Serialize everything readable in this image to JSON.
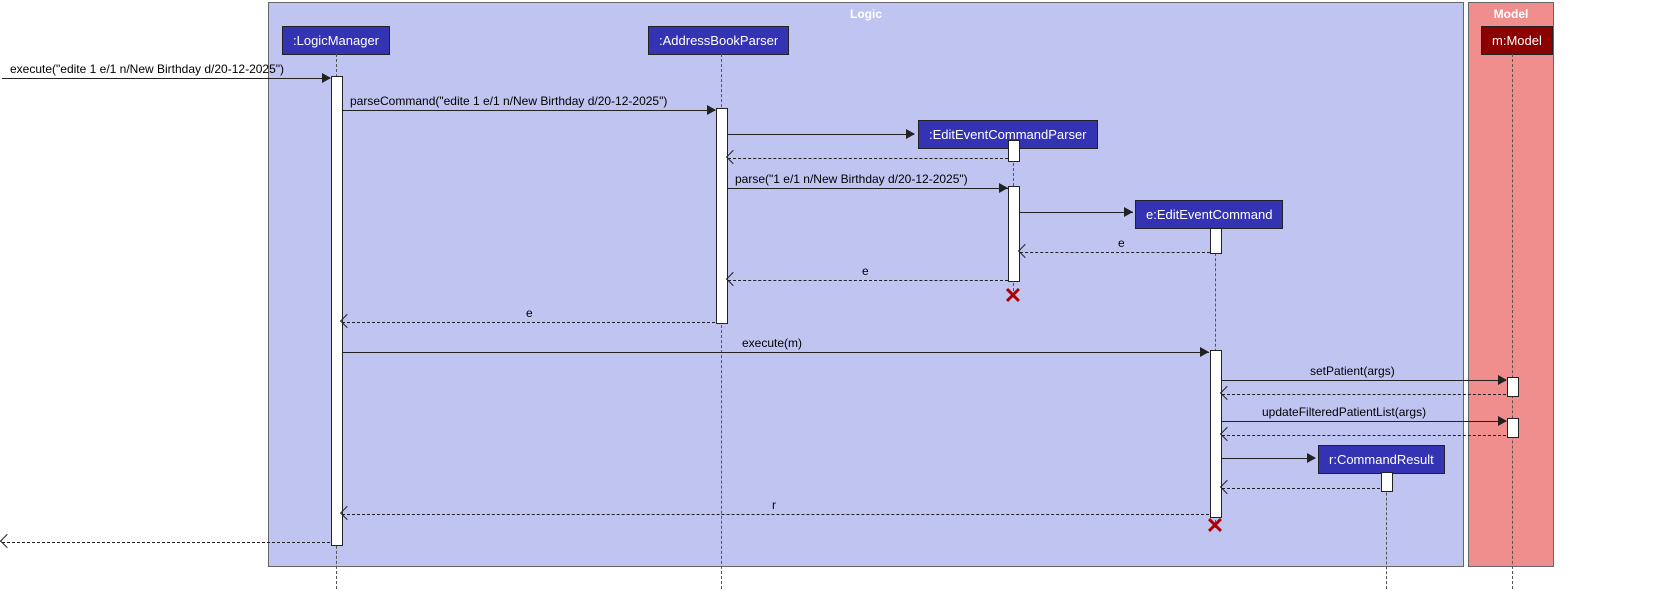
{
  "regions": {
    "logic": "Logic",
    "model": "Model"
  },
  "participants": {
    "logicManager": ":LogicManager",
    "addressBookParser": ":AddressBookParser",
    "editEventCommandParser": ":EditEventCommandParser",
    "editEventCommand": "e:EditEventCommand",
    "commandResult": "r:CommandResult",
    "model": "m:Model"
  },
  "messages": {
    "executeIn": "execute(\"edite 1 e/1 n/New Birthday d/20-12-2025\")",
    "parseCommand": "parseCommand(\"edite 1 e/1 n/New Birthday d/20-12-2025\")",
    "parse": "parse(\"1 e/1 n/New Birthday d/20-12-2025\")",
    "e1": "e",
    "e2": "e",
    "e3": "e",
    "executeM": "execute(m)",
    "setPatient": "setPatient(args)",
    "updateFiltered": "updateFilteredPatientList(args)",
    "r": "r"
  },
  "chart_data": {
    "type": "sequence-diagram",
    "regions": [
      {
        "name": "Logic",
        "participants": [
          ":LogicManager",
          ":AddressBookParser",
          ":EditEventCommandParser",
          "e:EditEventCommand",
          "r:CommandResult"
        ]
      },
      {
        "name": "Model",
        "participants": [
          "m:Model"
        ]
      }
    ],
    "lifelines": [
      ":LogicManager",
      ":AddressBookParser",
      ":EditEventCommandParser",
      "e:EditEventCommand",
      "r:CommandResult",
      "m:Model"
    ],
    "messages": [
      {
        "from": "Caller",
        "to": ":LogicManager",
        "label": "execute(\"edite 1 e/1 n/New Birthday d/20-12-2025\")",
        "type": "sync"
      },
      {
        "from": ":LogicManager",
        "to": ":AddressBookParser",
        "label": "parseCommand(\"edite 1 e/1 n/New Birthday d/20-12-2025\")",
        "type": "sync"
      },
      {
        "from": ":AddressBookParser",
        "to": ":EditEventCommandParser",
        "label": "",
        "type": "create"
      },
      {
        "from": ":EditEventCommandParser",
        "to": ":AddressBookParser",
        "label": "",
        "type": "return"
      },
      {
        "from": ":AddressBookParser",
        "to": ":EditEventCommandParser",
        "label": "parse(\"1 e/1 n/New Birthday d/20-12-2025\")",
        "type": "sync"
      },
      {
        "from": ":EditEventCommandParser",
        "to": "e:EditEventCommand",
        "label": "",
        "type": "create"
      },
      {
        "from": "e:EditEventCommand",
        "to": ":EditEventCommandParser",
        "label": "e",
        "type": "return"
      },
      {
        "from": ":EditEventCommandParser",
        "to": ":AddressBookParser",
        "label": "e",
        "type": "return"
      },
      {
        "from": ":EditEventCommandParser",
        "to": null,
        "label": "",
        "type": "destroy"
      },
      {
        "from": ":AddressBookParser",
        "to": ":LogicManager",
        "label": "e",
        "type": "return"
      },
      {
        "from": ":LogicManager",
        "to": "e:EditEventCommand",
        "label": "execute(m)",
        "type": "sync"
      },
      {
        "from": "e:EditEventCommand",
        "to": "m:Model",
        "label": "setPatient(args)",
        "type": "sync"
      },
      {
        "from": "m:Model",
        "to": "e:EditEventCommand",
        "label": "",
        "type": "return"
      },
      {
        "from": "e:EditEventCommand",
        "to": "m:Model",
        "label": "updateFilteredPatientList(args)",
        "type": "sync"
      },
      {
        "from": "m:Model",
        "to": "e:EditEventCommand",
        "label": "",
        "type": "return"
      },
      {
        "from": "e:EditEventCommand",
        "to": "r:CommandResult",
        "label": "",
        "type": "create"
      },
      {
        "from": "r:CommandResult",
        "to": "e:EditEventCommand",
        "label": "",
        "type": "return"
      },
      {
        "from": "e:EditEventCommand",
        "to": ":LogicManager",
        "label": "r",
        "type": "return"
      },
      {
        "from": "e:EditEventCommand",
        "to": null,
        "label": "",
        "type": "destroy"
      },
      {
        "from": ":LogicManager",
        "to": "Caller",
        "label": "",
        "type": "return"
      }
    ]
  }
}
